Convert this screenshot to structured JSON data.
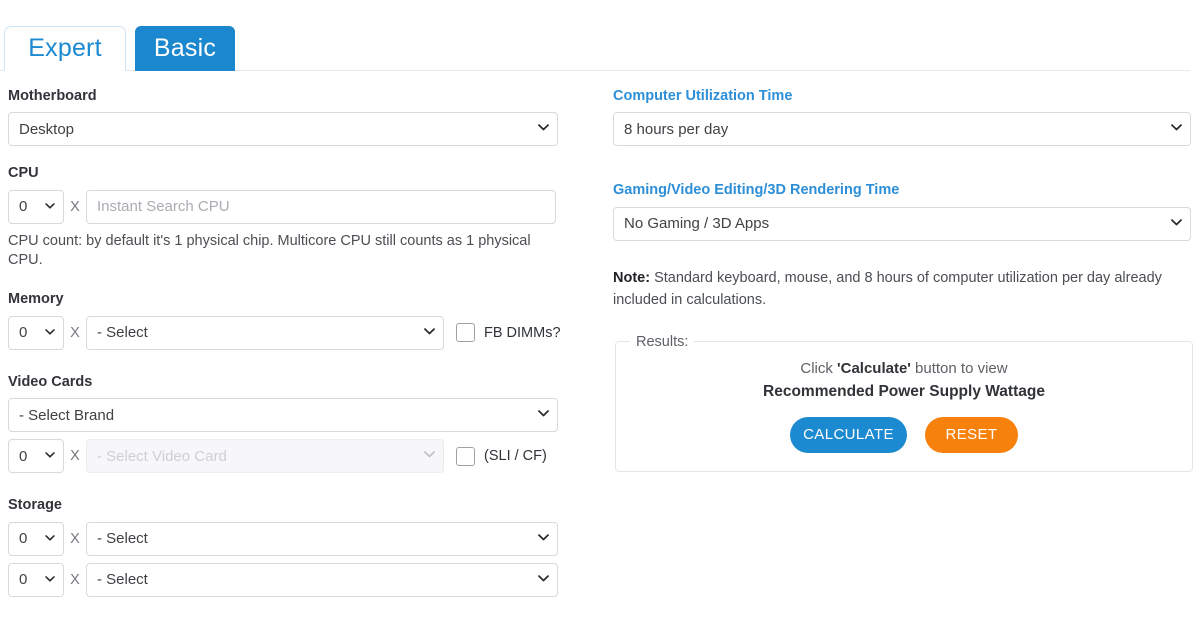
{
  "tabs": [
    {
      "label": "Expert",
      "active": true
    },
    {
      "label": "Basic",
      "active": false
    }
  ],
  "left": {
    "motherboard": {
      "label": "Motherboard",
      "value": "Desktop"
    },
    "cpu": {
      "label": "CPU",
      "qty": "0",
      "multiplier": "X",
      "search_placeholder": "Instant Search CPU",
      "hint": "CPU count: by default it's 1 physical chip. Multicore CPU still counts as 1 physical CPU."
    },
    "memory": {
      "label": "Memory",
      "qty": "0",
      "multiplier": "X",
      "value": "- Select",
      "checkbox_label": "FB DIMMs?"
    },
    "video_cards": {
      "label": "Video Cards",
      "brand_value": "- Select Brand",
      "qty": "0",
      "multiplier": "X",
      "card_value": "- Select Video Card",
      "checkbox_label": "(SLI / CF)"
    },
    "storage": {
      "label": "Storage",
      "rows": [
        {
          "qty": "0",
          "multiplier": "X",
          "value": "- Select"
        },
        {
          "qty": "0",
          "multiplier": "X",
          "value": "- Select"
        }
      ]
    }
  },
  "right": {
    "utilization": {
      "label": "Computer Utilization Time",
      "value": "8 hours per day"
    },
    "gaming": {
      "label": "Gaming/Video Editing/3D Rendering Time",
      "value": "No Gaming / 3D Apps"
    },
    "note": {
      "prefix": "Note:",
      "text": " Standard keyboard, mouse, and 8 hours of computer utilization per day already included in calculations."
    },
    "results": {
      "legend": "Results:",
      "line1_pre": "Click ",
      "line1_strong": "'Calculate'",
      "line1_post": " button to view",
      "line2": "Recommended Power Supply Wattage",
      "calculate_label": "CALCULATE",
      "reset_label": "RESET"
    }
  },
  "icons": {
    "chevron_down": "⌄"
  },
  "colors": {
    "tab_active_blue": "#1b87ce",
    "link_blue": "#2c8fd8",
    "calculate_blue": "#1c8ad1",
    "reset_orange": "#f6820d"
  }
}
